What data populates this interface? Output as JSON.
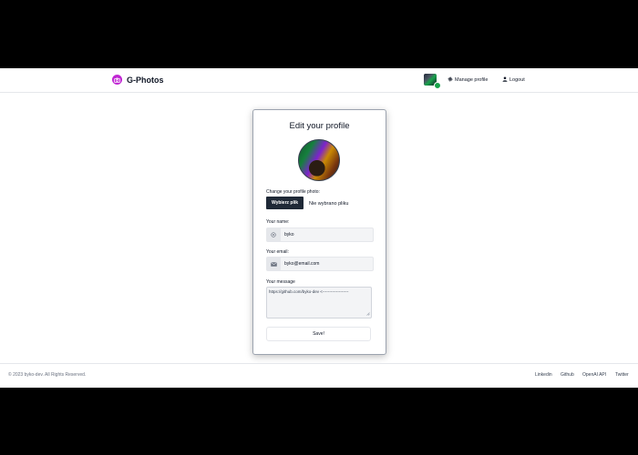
{
  "navbar": {
    "brand": "G-Photos",
    "manage_profile": "Manage profile",
    "logout": "Logout"
  },
  "form": {
    "title": "Edit your profile",
    "photo_label": "Change your profile photo:",
    "file_button": "Wybierz plik",
    "file_status": "Nie wybrano pliku",
    "name_label": "Your name:",
    "name_value": "byko",
    "email_label": "Your email:",
    "email_value": "byko@email.com",
    "message_label": "Your message",
    "message_value": "https://github.com/byko-dev <-------------------",
    "save_label": "Save!"
  },
  "footer": {
    "copyright": "© 2023 byko-dev. All Rights Reserved.",
    "links": [
      "Linkedin",
      "Github",
      "OpenAI API",
      "Twitter"
    ]
  },
  "colors": {
    "brand_icon": "#c026d3",
    "file_button": "#1f2937",
    "online_badge": "#16a34a"
  }
}
